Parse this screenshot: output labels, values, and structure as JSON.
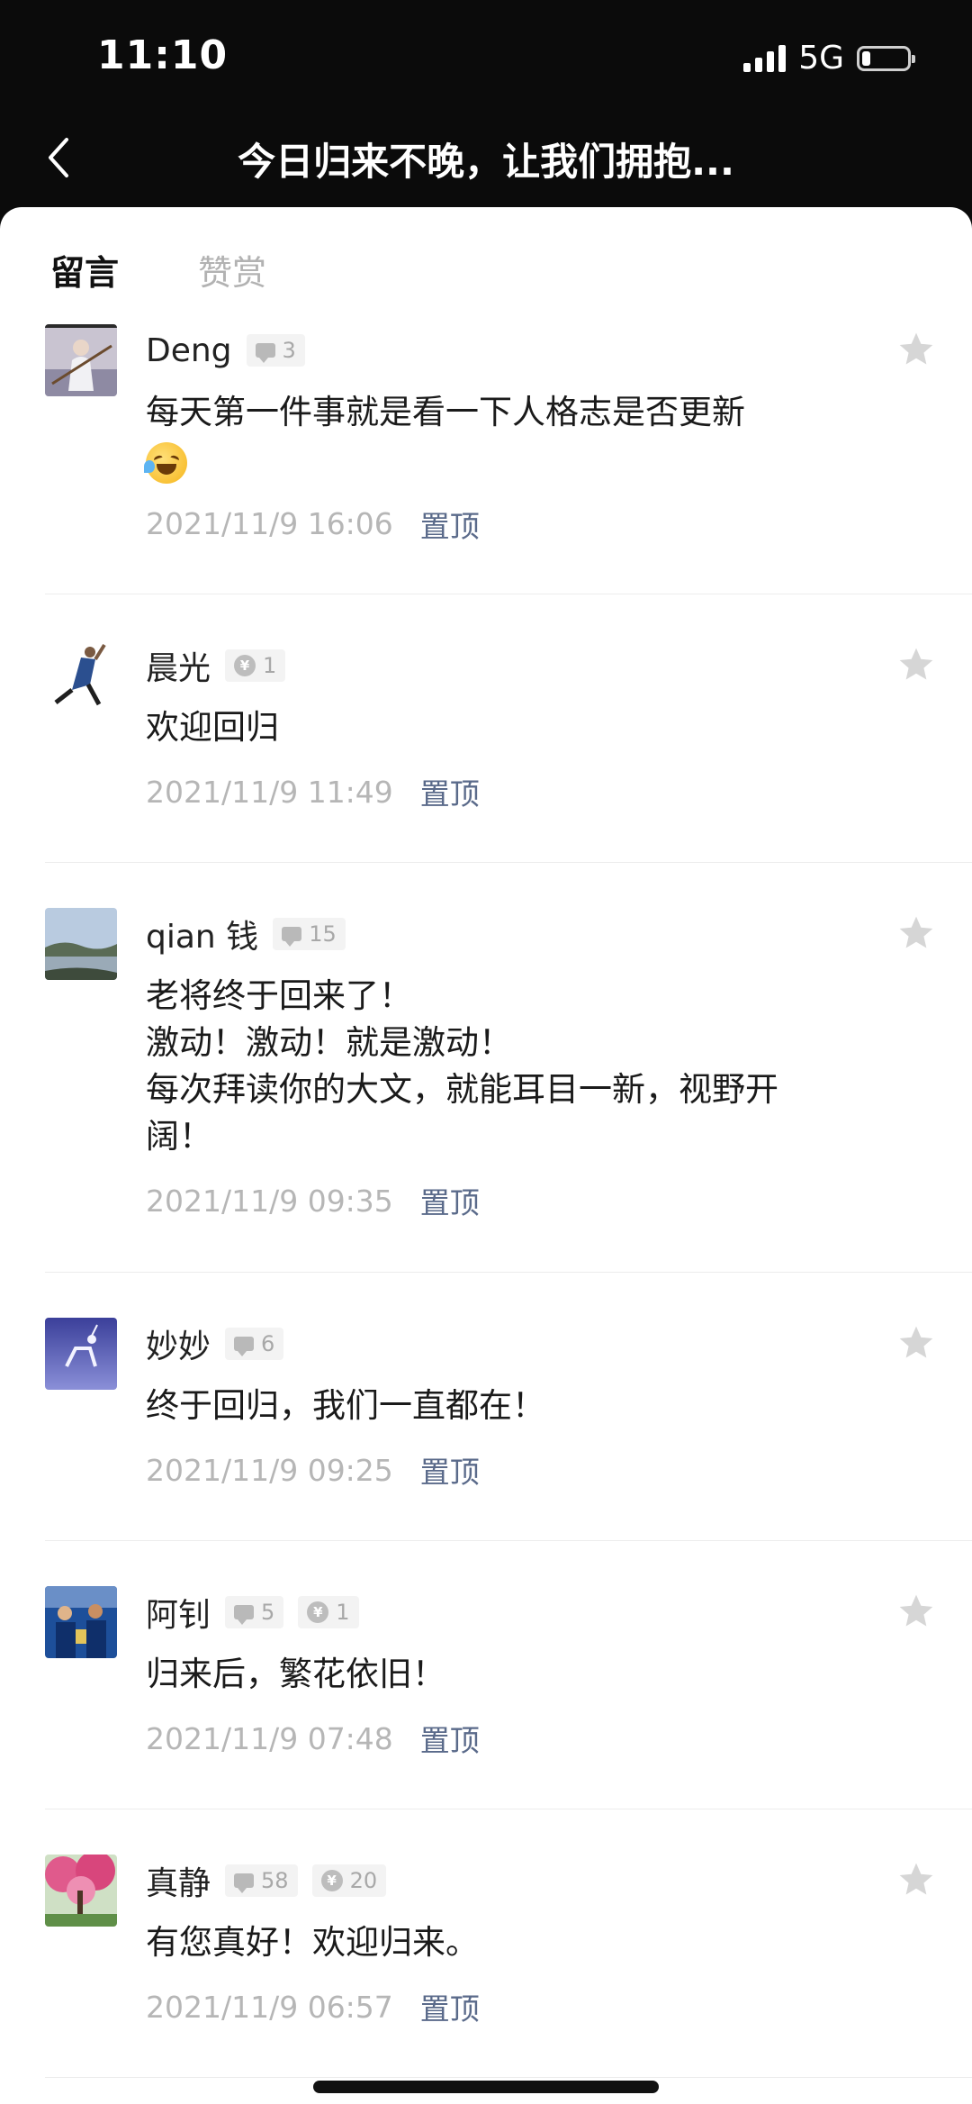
{
  "status_bar": {
    "time": "11:10",
    "network": "5G",
    "battery_level": 0.18
  },
  "nav": {
    "back_icon": "chevron-left-icon",
    "title": "今日归来不晚，让我们拥抱..."
  },
  "tabs": [
    {
      "label": "留言",
      "active": true
    },
    {
      "label": "赞赏",
      "active": false
    }
  ],
  "comments": [
    {
      "name": "Deng",
      "badges": [
        {
          "icon": "comment-icon",
          "count": "3"
        }
      ],
      "text": "每天第一件事就是看一下人格志是否更新",
      "emoji": "laughing-tears-emoji",
      "time": "2021/11/9 16:06",
      "pin_label": "置顶"
    },
    {
      "name": "晨光",
      "badges": [
        {
          "icon": "coin-icon",
          "count": "1"
        }
      ],
      "text": "欢迎回归",
      "time": "2021/11/9 11:49",
      "pin_label": "置顶"
    },
    {
      "name": "qian 钱",
      "badges": [
        {
          "icon": "comment-icon",
          "count": "15"
        }
      ],
      "text": "老将终于回来了！\n激动！激动！就是激动！\n每次拜读你的大文，就能耳目一新，视野开\n阔！",
      "time": "2021/11/9 09:35",
      "pin_label": "置顶"
    },
    {
      "name": "妙妙",
      "badges": [
        {
          "icon": "comment-icon",
          "count": "6"
        }
      ],
      "text": "终于回归，我们一直都在！",
      "time": "2021/11/9 09:25",
      "pin_label": "置顶"
    },
    {
      "name": "阿钊",
      "badges": [
        {
          "icon": "comment-icon",
          "count": "5"
        },
        {
          "icon": "coin-icon",
          "count": "1"
        }
      ],
      "text": "归来后，繁花依旧！",
      "time": "2021/11/9 07:48",
      "pin_label": "置顶"
    },
    {
      "name": "真静",
      "badges": [
        {
          "icon": "comment-icon",
          "count": "58"
        },
        {
          "icon": "coin-icon",
          "count": "20"
        }
      ],
      "text": "有您真好！欢迎归来。",
      "time": "2021/11/9 06:57",
      "pin_label": "置顶"
    }
  ],
  "colors": {
    "header_bg": "#0b0b0b",
    "pin_link": "#5a6a8a",
    "timestamp": "#b6b6b6",
    "star": "#d6d6d6"
  }
}
